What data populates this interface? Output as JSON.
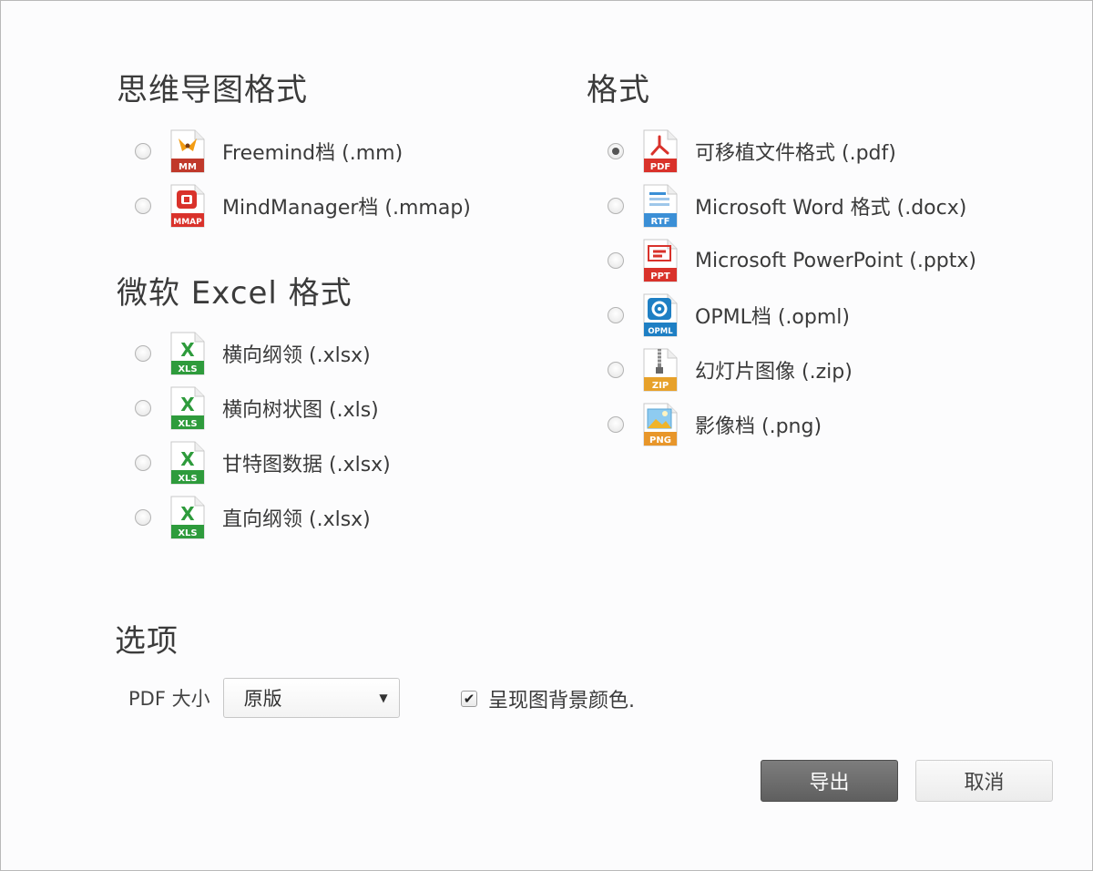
{
  "mindmap": {
    "title": "思维导图格式",
    "items": [
      {
        "label": "Freemind档 (.mm)",
        "icon": "freemind-file-icon",
        "checked": false
      },
      {
        "label": "MindManager档 (.mmap)",
        "icon": "mindmanager-file-icon",
        "checked": false
      }
    ]
  },
  "excel": {
    "title": "微软 Excel 格式",
    "items": [
      {
        "label": "横向纲领 (.xlsx)",
        "icon": "excel-file-icon",
        "checked": false
      },
      {
        "label": "横向树状图 (.xls)",
        "icon": "excel-file-icon",
        "checked": false
      },
      {
        "label": "甘特图数据 (.xlsx)",
        "icon": "excel-file-icon",
        "checked": false
      },
      {
        "label": "直向纲领 (.xlsx)",
        "icon": "excel-file-icon",
        "checked": false
      }
    ]
  },
  "formats": {
    "title": "格式",
    "items": [
      {
        "label": "可移植文件格式 (.pdf)",
        "icon": "pdf-file-icon",
        "checked": true
      },
      {
        "label": "Microsoft Word 格式 (.docx)",
        "icon": "rtf-file-icon",
        "checked": false
      },
      {
        "label": "Microsoft PowerPoint (.pptx)",
        "icon": "ppt-file-icon",
        "checked": false
      },
      {
        "label": "OPML档 (.opml)",
        "icon": "opml-file-icon",
        "checked": false
      },
      {
        "label": "幻灯片图像 (.zip)",
        "icon": "zip-file-icon",
        "checked": false
      },
      {
        "label": "影像档 (.png)",
        "icon": "png-file-icon",
        "checked": false
      }
    ]
  },
  "options": {
    "title": "选项",
    "pdf_size_label": "PDF 大小",
    "pdf_size_value": "原版",
    "background_checkbox_label": "呈现图背景颜色.",
    "background_checked": true
  },
  "buttons": {
    "export": "导出",
    "cancel": "取消"
  },
  "colors": {
    "excel": "#2e9b3c",
    "pdf": "#d9322b",
    "rtf": "#3b8fd6",
    "ppt": "#d9322b",
    "opml": "#1e7fc4",
    "zip": "#e7a12a",
    "png": "#e8962a",
    "freemind": "#c0392b",
    "mindmanager": "#d9322b"
  }
}
